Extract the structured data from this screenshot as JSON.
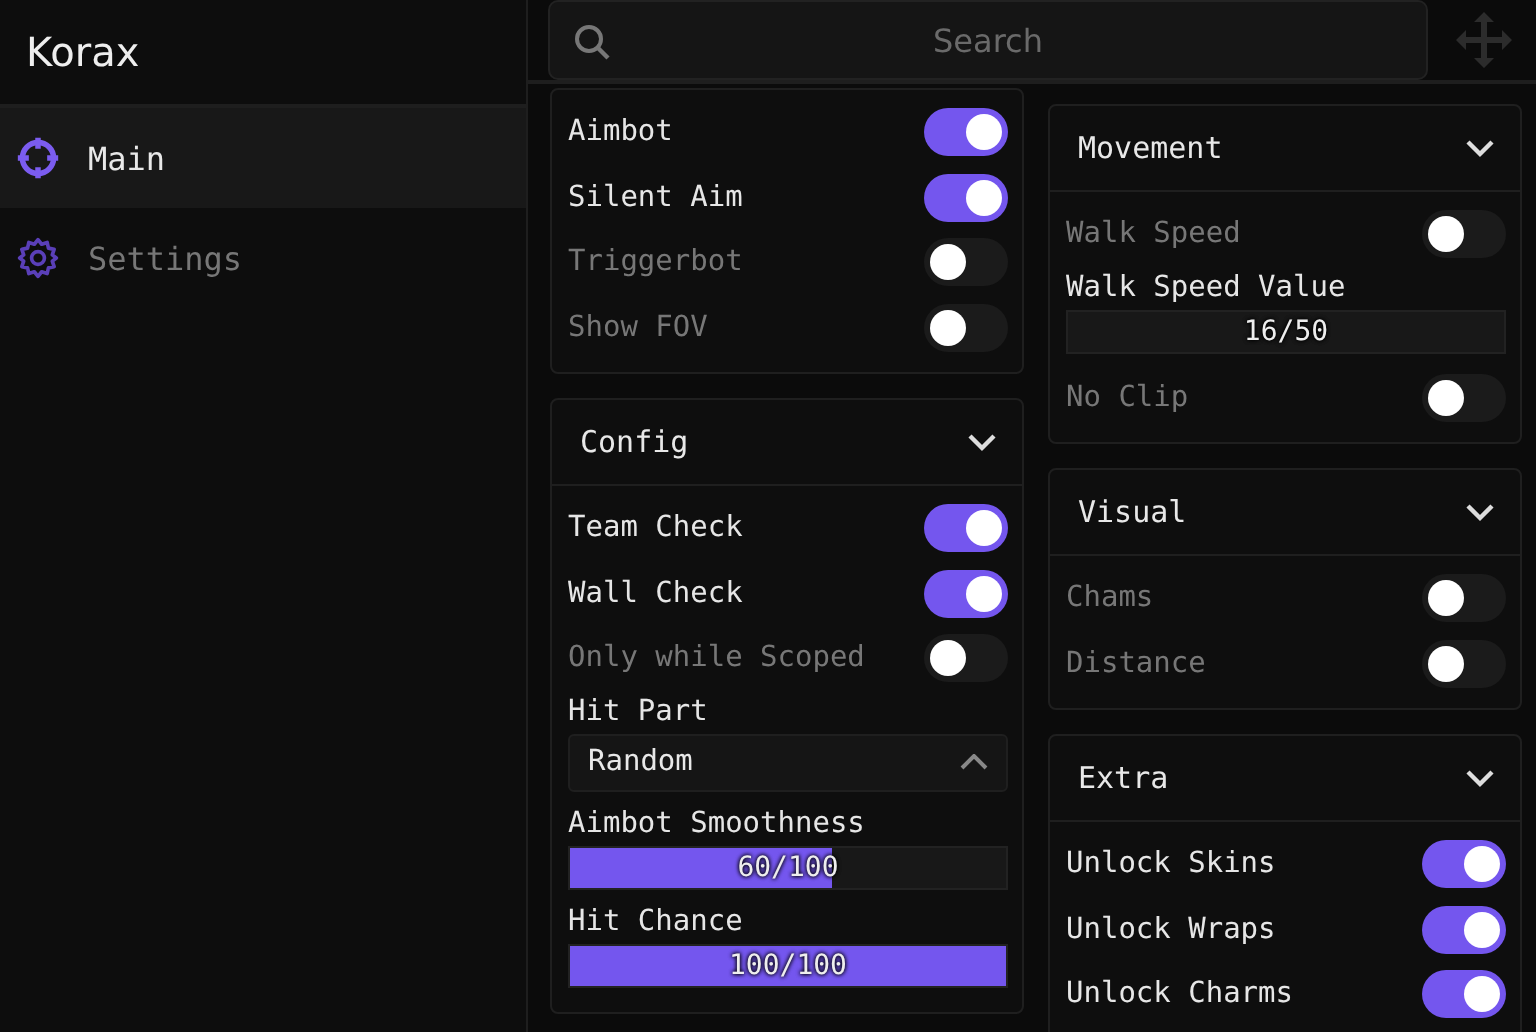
{
  "app": {
    "title": "Korax"
  },
  "sidebar": {
    "items": [
      {
        "label": "Main",
        "kind": "crosshair",
        "selected": true
      },
      {
        "label": "Settings",
        "kind": "gear",
        "selected": false
      }
    ]
  },
  "search": {
    "placeholder": "Search"
  },
  "columns": [
    {
      "sections": [
        {
          "items": [
            {
              "kind": "toggle",
              "label": "Aimbot",
              "on": true
            },
            {
              "kind": "toggle",
              "label": "Silent Aim",
              "on": true
            },
            {
              "kind": "toggle",
              "label": "Triggerbot",
              "on": false
            },
            {
              "kind": "toggle",
              "label": "Show FOV",
              "on": false
            }
          ]
        },
        {
          "title": "Config",
          "expanded": true,
          "items": [
            {
              "kind": "toggle",
              "label": "Team Check",
              "on": true
            },
            {
              "kind": "toggle",
              "label": "Wall Check",
              "on": true
            },
            {
              "kind": "toggle",
              "label": "Only while Scoped",
              "on": false
            },
            {
              "kind": "dropdown",
              "label": "Hit Part",
              "value": "Random",
              "expanded": true
            },
            {
              "kind": "slider",
              "label": "Aimbot Smoothness",
              "level": 0.6,
              "reading": "60/100"
            },
            {
              "kind": "slider",
              "label": "Hit Chance",
              "level": 1,
              "reading": "100/100"
            }
          ]
        }
      ]
    },
    {
      "sections": [
        {
          "title": "Movement",
          "expanded": true,
          "items": [
            {
              "kind": "toggle",
              "label": "Walk Speed",
              "on": false
            },
            {
              "kind": "slider",
              "label": "Walk Speed Value",
              "reading": "16/50"
            },
            {
              "kind": "toggle",
              "label": "No Clip",
              "on": false
            }
          ]
        },
        {
          "title": "Visual",
          "expanded": true,
          "items": [
            {
              "kind": "toggle",
              "label": "Chams",
              "on": false
            },
            {
              "kind": "toggle",
              "label": "Distance",
              "on": false
            }
          ]
        },
        {
          "title": "Extra",
          "expanded": true,
          "items": [
            {
              "kind": "toggle",
              "label": "Unlock Skins",
              "on": true
            },
            {
              "kind": "toggle",
              "label": "Unlock Wraps",
              "on": true
            },
            {
              "kind": "toggle",
              "label": "Unlock Charms",
              "on": true
            }
          ]
        }
      ]
    }
  ]
}
